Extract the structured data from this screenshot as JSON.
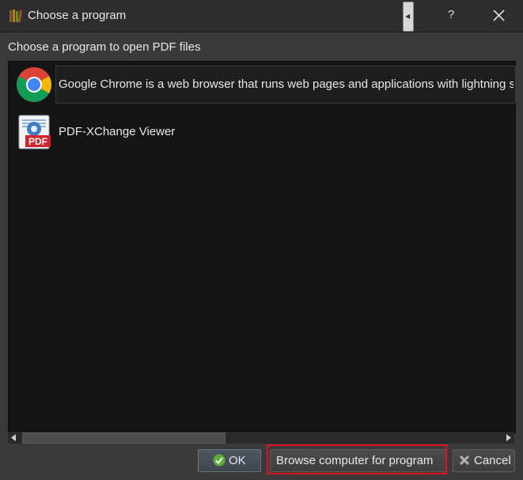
{
  "window": {
    "title": "Choose a program",
    "help_label": "?",
    "app_icon": "books-icon",
    "close_icon": "close-icon"
  },
  "prompt": "Choose a program to open PDF files",
  "programs": [
    {
      "label": "Google Chrome is a web browser that runs web pages and applications with lightning s",
      "icon": "chrome-icon",
      "selected": true
    },
    {
      "label": "PDF-XChange Viewer",
      "icon": "pdf-xchange-icon",
      "selected": false
    }
  ],
  "buttons": {
    "ok_label": "OK",
    "browse_label": "Browse computer for program",
    "cancel_label": "Cancel"
  },
  "colors": {
    "highlight": "#e4121e",
    "list_background": "#151515",
    "dialog_background": "#3a3a3a"
  }
}
